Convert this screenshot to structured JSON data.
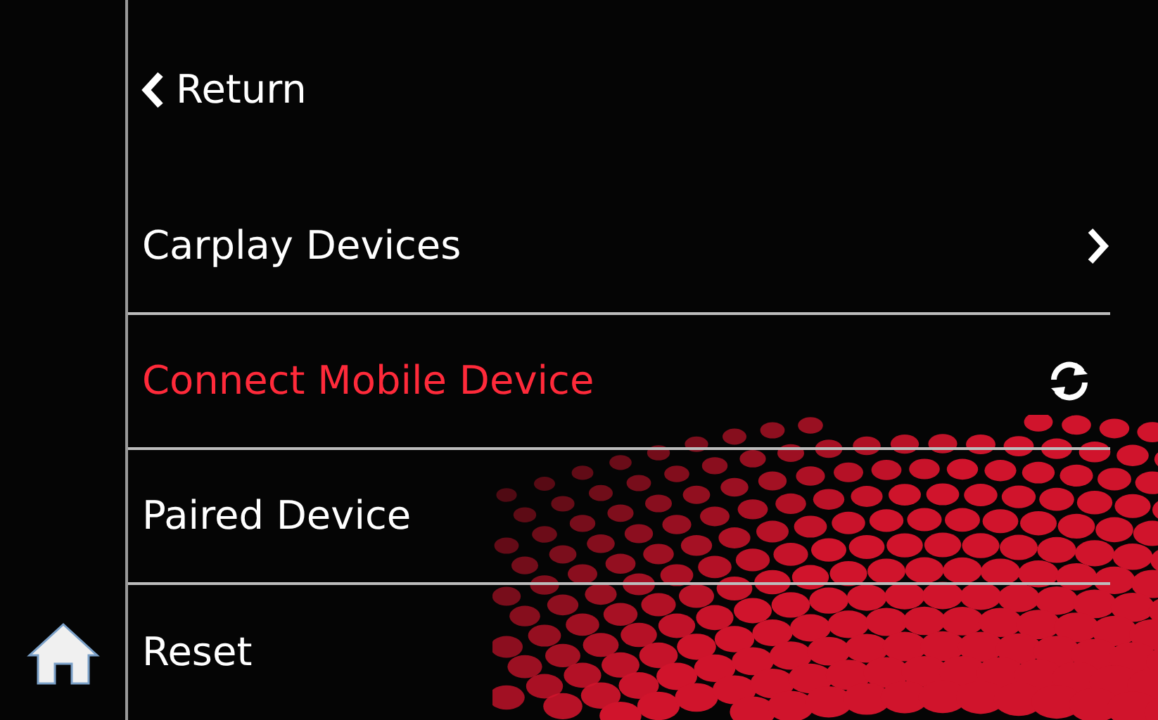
{
  "back": {
    "label": "Return"
  },
  "menu": [
    {
      "label": "Carplay Devices",
      "selected": false,
      "kind": "chevron"
    },
    {
      "label": "Connect Mobile Device",
      "selected": true,
      "kind": "sync"
    },
    {
      "label": "Paired Device",
      "selected": false,
      "kind": "plain"
    },
    {
      "label": "Reset",
      "selected": false,
      "kind": "plain"
    }
  ]
}
